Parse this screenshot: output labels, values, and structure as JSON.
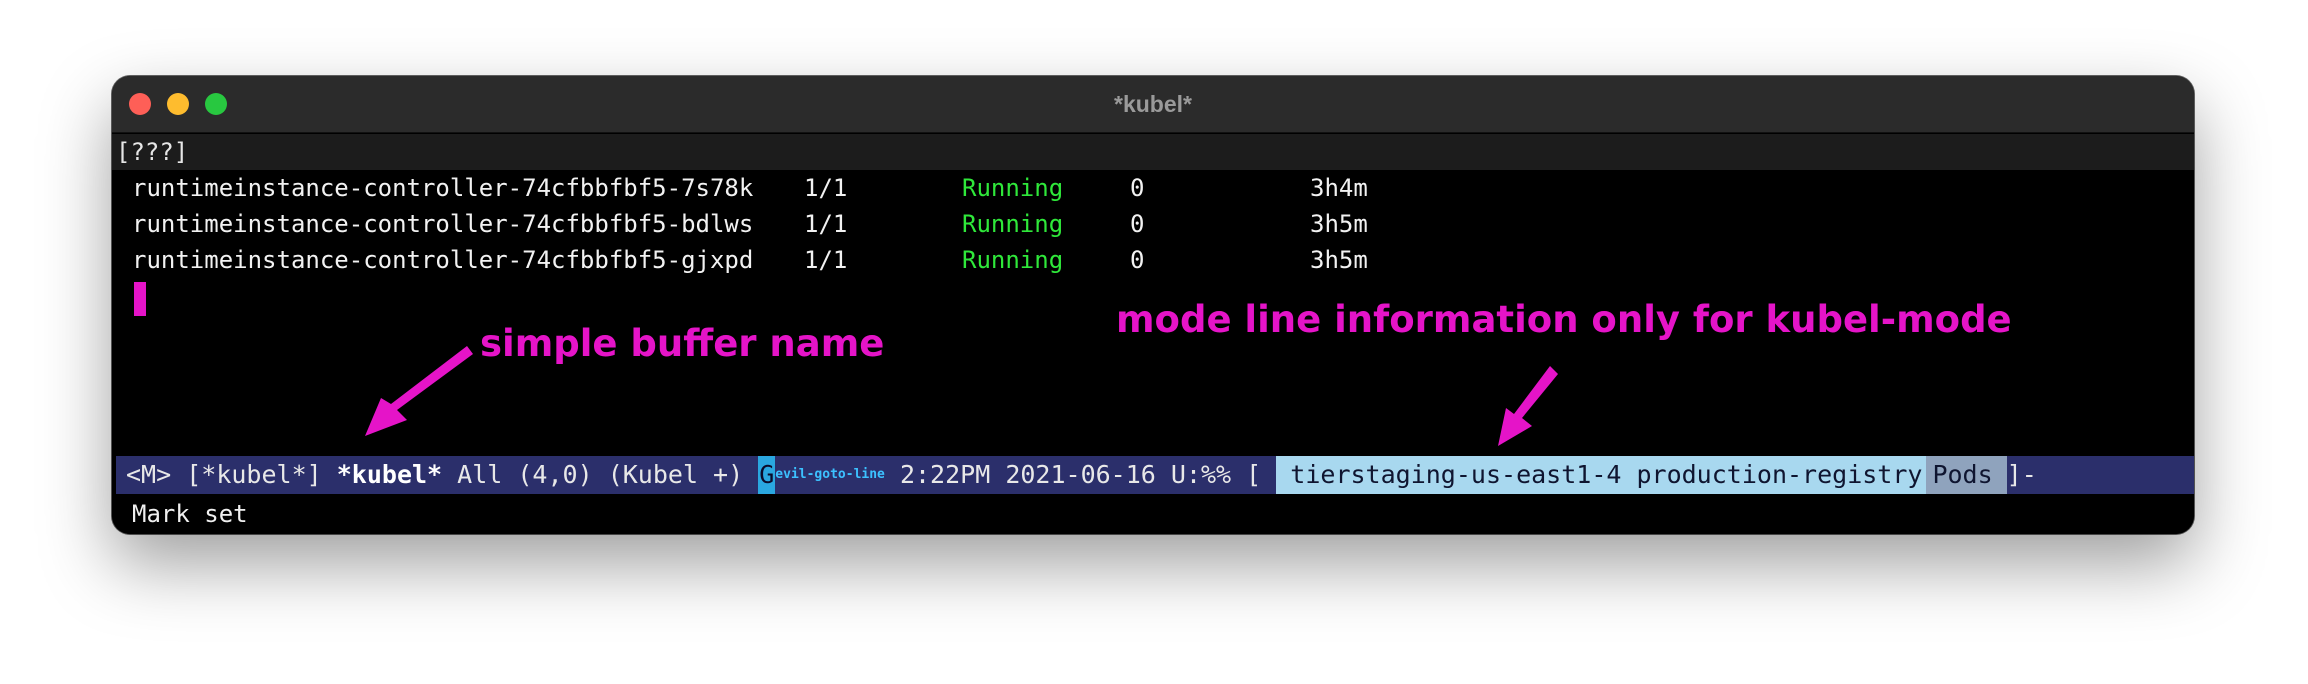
{
  "window": {
    "title": "*kubel*"
  },
  "header_line": "[???]",
  "pods": [
    {
      "name": "runtimeinstance-controller-74cfbbfbf5-7s78k",
      "ready": "1/1",
      "status": "Running",
      "restarts": "0",
      "age": "3h4m"
    },
    {
      "name": "runtimeinstance-controller-74cfbbfbf5-bdlws",
      "ready": "1/1",
      "status": "Running",
      "restarts": "0",
      "age": "3h5m"
    },
    {
      "name": "runtimeinstance-controller-74cfbbfbf5-gjxpd",
      "ready": "1/1",
      "status": "Running",
      "restarts": "0",
      "age": "3h5m"
    }
  ],
  "annotations": {
    "buffer_name": "simple buffer name",
    "mode_line": "mode line information only for kubel-mode"
  },
  "mode_line": {
    "evil_state": "<M>",
    "buffer_bracket": "[*kubel*]",
    "buffer_name": "*kubel*",
    "position": "All (4,0)",
    "major_mode": "(Kubel +)",
    "evil_indicator": "G",
    "evil_command": "evil-goto-line",
    "time": "2:22PM",
    "date": "2021-06-16",
    "encoding": "U:%%",
    "open_bracket": "[",
    "context": "tierstaging-us-east1-4 production-registry",
    "resource": "Pods",
    "close_bracket": "]-"
  },
  "echo_area": "Mark set",
  "colors": {
    "annotation": "#e514c8",
    "running": "#2fe83a",
    "modeline_bg": "#2b2f6b",
    "context_bg": "#a8d8ef",
    "resource_bg": "#8fa3bd"
  }
}
